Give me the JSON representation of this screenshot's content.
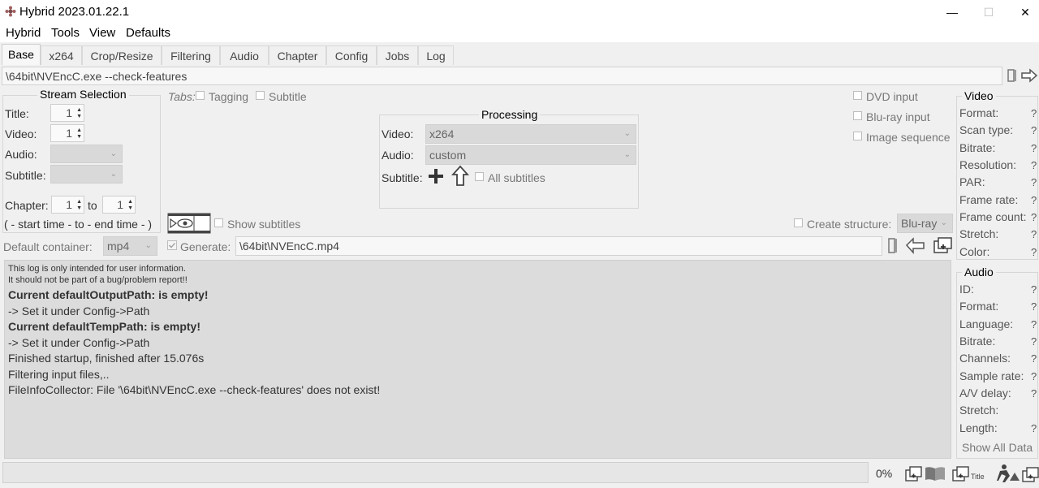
{
  "window": {
    "title": "Hybrid 2023.01.22.1",
    "minimize": "—",
    "maximize": "☐",
    "close": "✕"
  },
  "menu": [
    "Hybrid",
    "Tools",
    "View",
    "Defaults"
  ],
  "tabs": [
    "Base",
    "x264",
    "Crop/Resize",
    "Filtering",
    "Audio",
    "Chapter",
    "Config",
    "Jobs",
    "Log"
  ],
  "input_path": "\\64bit\\NVEncC.exe --check-features",
  "stream_selection": {
    "title": "Stream Selection",
    "title_label": "Title:",
    "title_value": "1",
    "video_label": "Video:",
    "video_value": "1",
    "audio_label": "Audio:",
    "subtitle_label": "Subtitle:",
    "chapter_label": "Chapter:",
    "chapter_from": "1",
    "to_label": "to",
    "chapter_to": "1",
    "time_hint": "( - start time - to - end time - )"
  },
  "tabs_options": {
    "label": "Tabs:",
    "tagging": "Tagging",
    "subtitle": "Subtitle"
  },
  "processing": {
    "title": "Processing",
    "video_label": "Video:",
    "video_value": "x264",
    "audio_label": "Audio:",
    "audio_value": "custom",
    "subtitle_label": "Subtitle:",
    "all_subtitles": "All subtitles"
  },
  "input_options": {
    "dvd": "DVD input",
    "bluray": "Blu-ray input",
    "image_seq": "Image sequence"
  },
  "show_subtitles": "Show subtitles",
  "create_structure": {
    "label": "Create structure:",
    "value": "Blu-ray"
  },
  "container": {
    "label": "Default container:",
    "value": "mp4"
  },
  "generate": {
    "label": "Generate:",
    "value": "\\64bit\\NVEncC.mp4"
  },
  "log": [
    {
      "text": "This log is only intended for user information.",
      "style": "small"
    },
    {
      "text": "It should not be part of a bug/problem report!!",
      "style": "small"
    },
    {
      "text": "Current defaultOutputPath: is empty!",
      "style": "bold"
    },
    {
      "text": " -> Set it under Config->Path",
      "style": "normal"
    },
    {
      "text": "Current defaultTempPath: is empty!",
      "style": "bold"
    },
    {
      "text": " -> Set it under Config->Path",
      "style": "normal"
    },
    {
      "text": "Finished startup, finished after 15.076s",
      "style": "normal"
    },
    {
      "text": "Filtering input files,..",
      "style": "normal"
    },
    {
      "text": "FileInfoCollector: File '\\64bit\\NVEncC.exe --check-features' does not exist!",
      "style": "normal"
    }
  ],
  "video_info": {
    "title": "Video",
    "fields": [
      "Format:",
      "Scan type:",
      "Bitrate:",
      "Resolution:",
      "PAR:",
      "Frame rate:",
      "Frame count:",
      "Stretch:",
      "Color:"
    ],
    "unknown": "?"
  },
  "audio_info": {
    "title": "Audio",
    "fields": [
      "ID:",
      "Format:",
      "Language:",
      "Bitrate:",
      "Channels:",
      "Sample rate:",
      "A/V delay:",
      "Stretch:",
      "Length:"
    ],
    "unknown": "?",
    "show_all": "Show All Data"
  },
  "progress": {
    "value": 0,
    "label": "0%"
  },
  "bottom_icons": {
    "title_text": "Title"
  }
}
